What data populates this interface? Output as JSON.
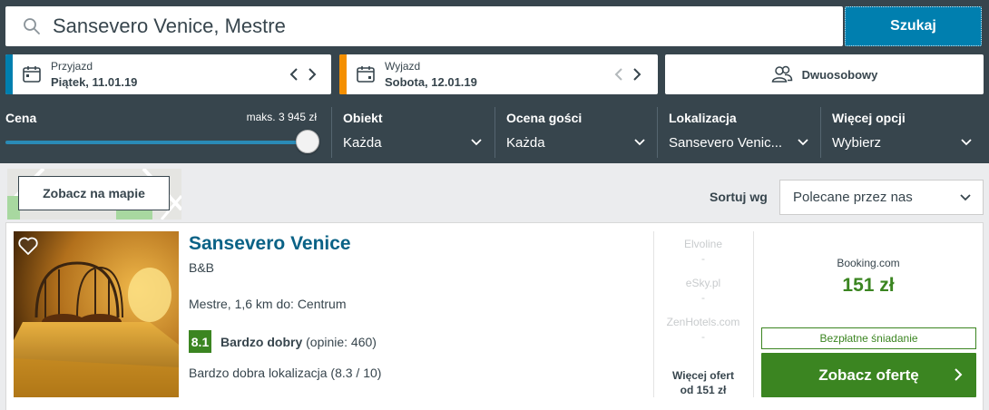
{
  "search": {
    "query": "Sansevero Venice, Mestre",
    "button_label": "Szukaj"
  },
  "checkin": {
    "label": "Przyjazd",
    "value": "Piątek, 11.01.19",
    "accent": "#007faf"
  },
  "checkout": {
    "label": "Wyjazd",
    "value": "Sobota, 12.01.19",
    "accent": "#f48f00"
  },
  "guests": {
    "label": "Dwuosobowy"
  },
  "filters": {
    "price": {
      "label": "Cena",
      "max_label": "maks. 3 945 zł"
    },
    "property": {
      "label": "Obiekt",
      "value": "Każda"
    },
    "guest_rating": {
      "label": "Ocena gości",
      "value": "Każda"
    },
    "location": {
      "label": "Lokalizacja",
      "value": "Sansevero Venic..."
    },
    "more": {
      "label": "Więcej opcji",
      "value": "Wybierz"
    }
  },
  "map": {
    "button_label": "Zobacz na mapie"
  },
  "sort": {
    "label": "Sortuj wg",
    "value": "Polecane przez nas"
  },
  "hotel": {
    "name": "Sansevero Venice",
    "type": "B&B",
    "location": "Mestre, 1,6 km do: Centrum",
    "score": "8.1",
    "rating_word": "Bardzo dobry",
    "reviews": " (opinie: 460)",
    "location_rating": "Bardzo dobra lokalizacja (8.3 / 10)",
    "other_offers": [
      {
        "name": "Elvoline",
        "price": "-"
      },
      {
        "name": "eSky.pl",
        "price": "-"
      },
      {
        "name": "ZenHotels.com",
        "price": "-"
      }
    ],
    "more_offers_line1": "Więcej ofert",
    "more_offers_line2": "od 151 zł",
    "provider": "Booking.com",
    "price": "151 zł",
    "perk": "Bezpłatne śniadanie",
    "cta": "Zobacz ofertę"
  },
  "colors": {
    "header": "#37454d",
    "search_button": "#007faf",
    "green": "#3b8521",
    "hotel_link": "#0a6286"
  }
}
